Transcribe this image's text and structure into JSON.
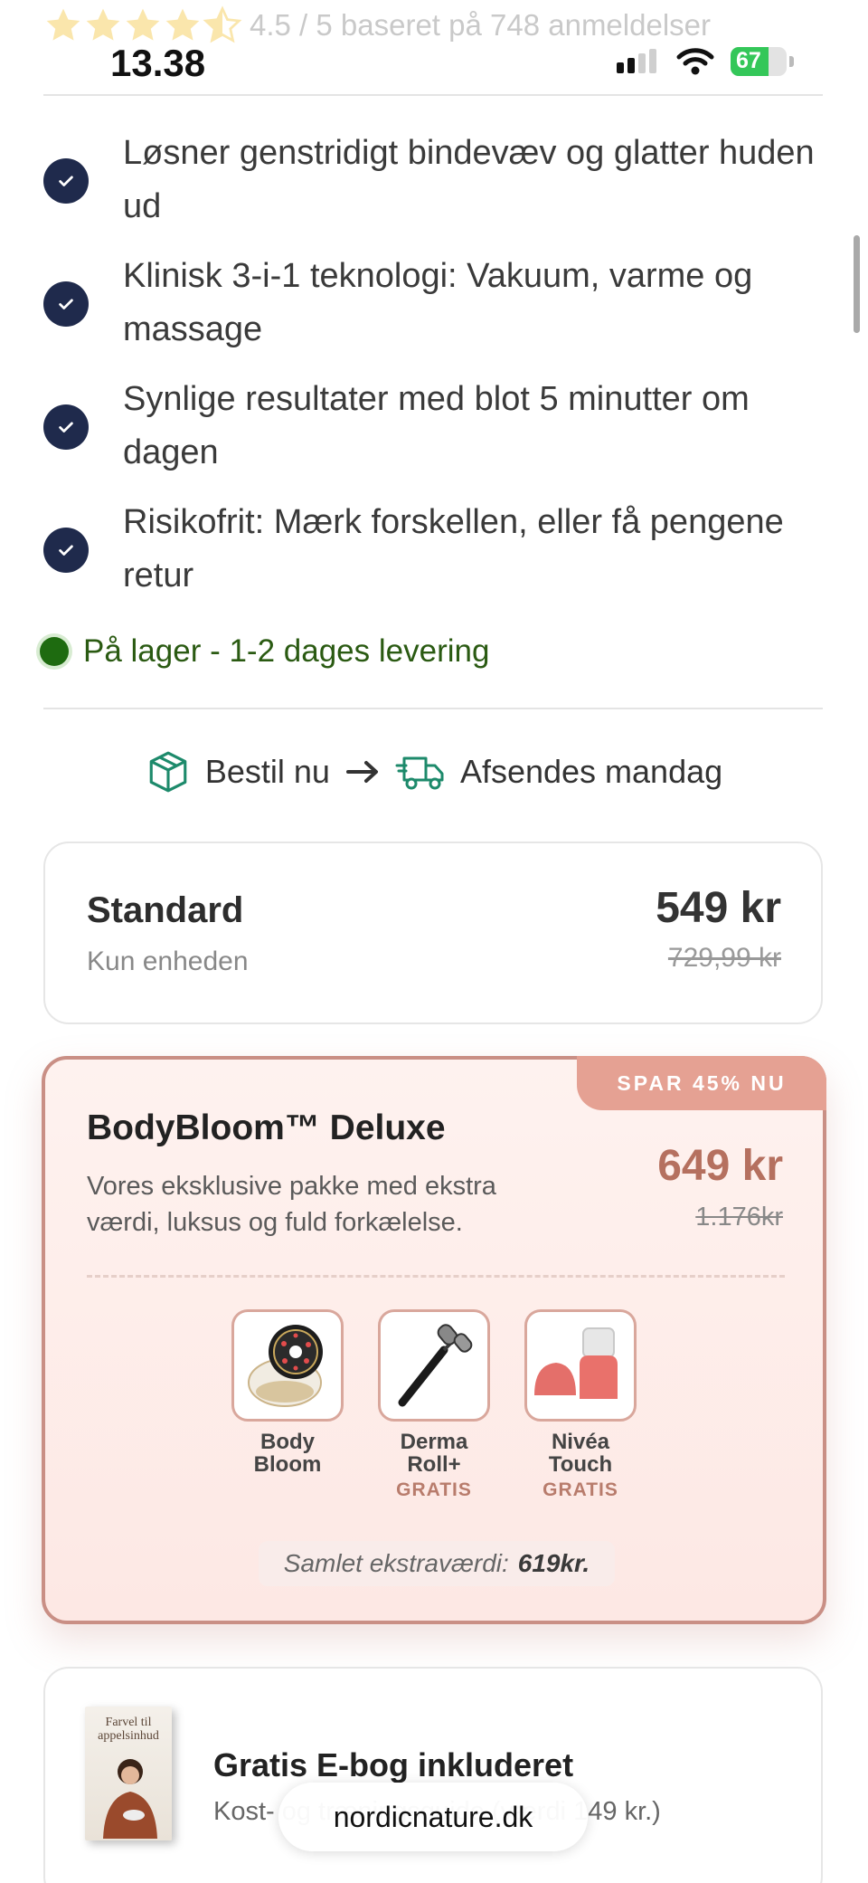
{
  "status_bar": {
    "time": "13.38",
    "battery": "67",
    "battery_level": 0.67
  },
  "rating": {
    "text": "4.5 / 5 baseret på 748 anmeldelser",
    "value": 4.5,
    "star_color": "#f6c84a"
  },
  "features": [
    {
      "text": "Løsner genstridigt bindevæv og glatter huden ud"
    },
    {
      "text": "Klinisk 3-i-1 teknologi: Vakuum, varme og massage"
    },
    {
      "text": "Synlige resultater med blot 5 minutter om dagen"
    },
    {
      "text": "Risikofrit: Mærk forskellen, eller få pengene retur"
    }
  ],
  "stock": {
    "text": "På lager - 1-2 dages levering",
    "color": "#1e6b10"
  },
  "shipping": {
    "order_label": "Bestil nu",
    "ship_label": "Afsendes mandag",
    "icon_color": "#1d8a6b"
  },
  "standard": {
    "title": "Standard",
    "subtitle": "Kun enheden",
    "price": "549 kr",
    "old_price": "729,99 kr"
  },
  "deluxe": {
    "badge": "SPAR 45% NU",
    "title": "BodyBloom™ Deluxe",
    "description": "Vores eksklusive pakke med ekstra værdi, luksus og fuld forkælelse.",
    "price": "649 kr",
    "old_price": "1.176kr",
    "accent": "#b5705f",
    "items": [
      {
        "name": "Body Bloom",
        "tag": ""
      },
      {
        "name": "Derma Roll+",
        "tag": "GRATIS"
      },
      {
        "name": "Nivéa Touch",
        "tag": "GRATIS"
      }
    ],
    "total_label": "Samlet ekstraværdi:",
    "total_value": "619kr."
  },
  "ebook": {
    "cover_title": "Farvel til appelsinhud",
    "title": "Gratis E-bog inkluderet",
    "subtitle": "Kost- og træningsguide (værdi 149 kr.)"
  },
  "browser": {
    "url": "nordicnature.dk"
  }
}
